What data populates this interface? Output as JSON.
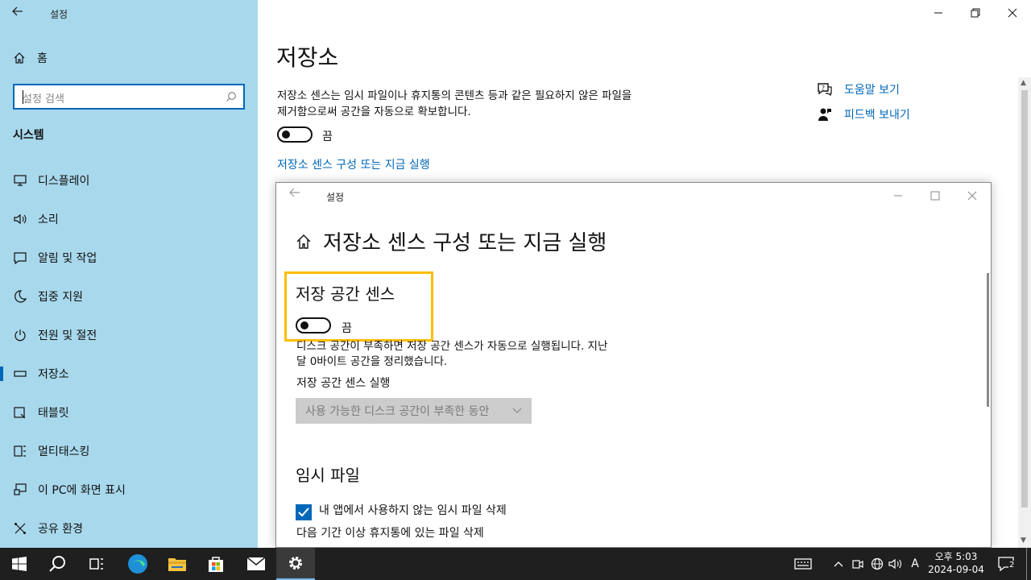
{
  "window": {
    "title": "설정"
  },
  "sidebar": {
    "home_label": "홈",
    "search_placeholder": "설정 검색",
    "section_title": "시스템",
    "items": [
      {
        "label": "디스플레이",
        "icon": "monitor-icon"
      },
      {
        "label": "소리",
        "icon": "speaker-icon"
      },
      {
        "label": "알림 및 작업",
        "icon": "notification-icon"
      },
      {
        "label": "집중 지원",
        "icon": "moon-icon"
      },
      {
        "label": "전원 및 절전",
        "icon": "power-icon"
      },
      {
        "label": "저장소",
        "icon": "storage-icon",
        "active": true
      },
      {
        "label": "태블릿",
        "icon": "tablet-icon"
      },
      {
        "label": "멀티태스킹",
        "icon": "multitask-icon"
      },
      {
        "label": "이 PC에 화면 표시",
        "icon": "project-icon"
      },
      {
        "label": "공유 환경",
        "icon": "share-icon"
      }
    ]
  },
  "main": {
    "title": "저장소",
    "description": "저장소 센스는 임시 파일이나 휴지통의 콘텐츠 등과 같은 필요하지 않은 파일을 제거함으로써 공간을 자동으로 확보합니다.",
    "toggle_state": "끔",
    "configure_link": "저장소 센스 구성 또는 지금 실행",
    "help_link": "도움말 보기",
    "feedback_link": "피드백 보내기"
  },
  "dialog": {
    "title": "설정",
    "heading": "저장소 센스 구성 또는 지금 실행",
    "section1_title": "저장 공간 센스",
    "toggle_state": "끔",
    "desc_line1": "디스크 공간이 부족하면 저장 공간 센스가 자동으로 실행됩니다. 지난",
    "desc_line2": "달 0바이트 공간을 정리했습니다.",
    "run_label": "저장 공간 센스 실행",
    "run_option": "사용 가능한 디스크 공간이 부족한 동안",
    "section2_title": "임시 파일",
    "checkbox_label": "내 앱에서 사용하지 않는 임시 파일 삭제",
    "recycle_label": "다음 기간 이상 휴지통에 있는 파일 삭제"
  },
  "taskbar": {
    "time": "오후 5:03",
    "date": "2024-09-04",
    "ime": "A",
    "notification_count": "2"
  },
  "colors": {
    "sidebar_bg": "#a8d8ec",
    "accent": "#0067b8",
    "highlight": "#ffbd00",
    "taskbar_bg": "#1f1f1f"
  }
}
